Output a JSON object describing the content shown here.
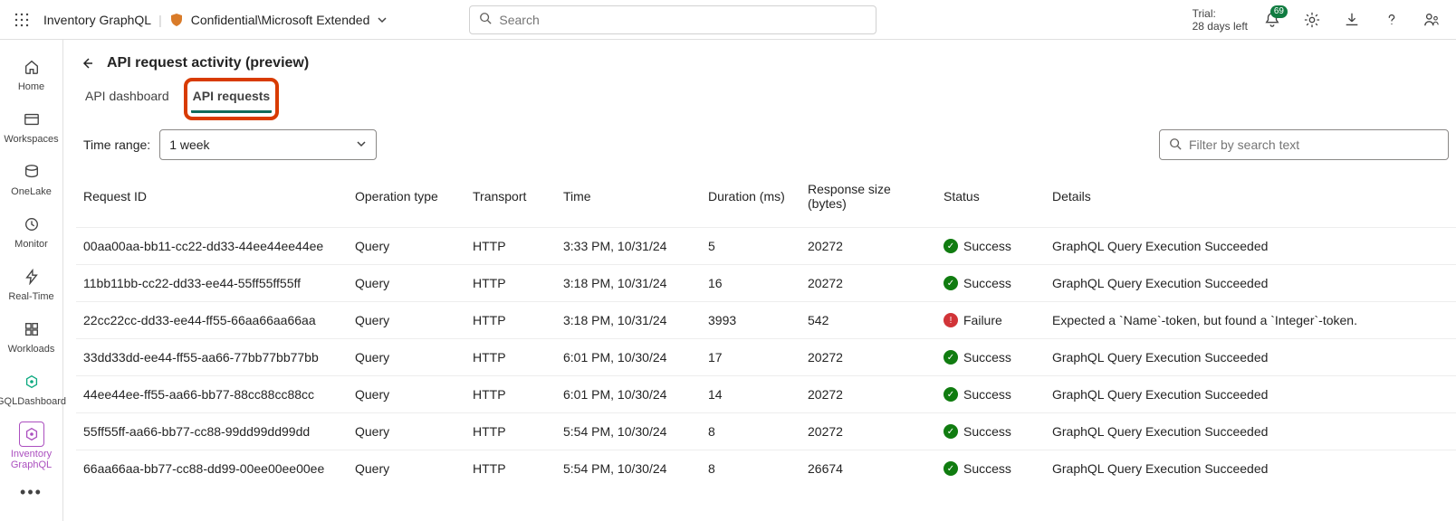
{
  "header": {
    "breadcrumb": {
      "item": "Inventory GraphQL",
      "sensitivity": "Confidential\\Microsoft Extended"
    },
    "search_placeholder": "Search",
    "trial_label": "Trial:",
    "trial_days": "28 days left",
    "notification_count": "69"
  },
  "rail": {
    "items": [
      {
        "label": "Home"
      },
      {
        "label": "Workspaces"
      },
      {
        "label": "OneLake"
      },
      {
        "label": "Monitor"
      },
      {
        "label": "Real-Time"
      },
      {
        "label": "Workloads"
      },
      {
        "label": "GQLDashboard"
      },
      {
        "label": "Inventory GraphQL"
      }
    ]
  },
  "page": {
    "title": "API request activity (preview)",
    "tabs": [
      {
        "label": "API dashboard"
      },
      {
        "label": "API requests"
      }
    ],
    "time_range_label": "Time range:",
    "time_range_value": "1 week",
    "filter_placeholder": "Filter by search text"
  },
  "columns": {
    "id": "Request ID",
    "op": "Operation type",
    "tr": "Transport",
    "time": "Time",
    "dur": "Duration (ms)",
    "size": "Response size (bytes)",
    "status": "Status",
    "details": "Details"
  },
  "rows": [
    {
      "id": "00aa00aa-bb11-cc22-dd33-44ee44ee44ee",
      "op": "Query",
      "tr": "HTTP",
      "time": "3:33 PM, 10/31/24",
      "dur": "5",
      "size": "20272",
      "status": "Success",
      "details": "GraphQL Query Execution Succeeded"
    },
    {
      "id": "11bb11bb-cc22-dd33-ee44-55ff55ff55ff",
      "op": "Query",
      "tr": "HTTP",
      "time": "3:18 PM, 10/31/24",
      "dur": "16",
      "size": "20272",
      "status": "Success",
      "details": "GraphQL Query Execution Succeeded"
    },
    {
      "id": "22cc22cc-dd33-ee44-ff55-66aa66aa66aa",
      "op": "Query",
      "tr": "HTTP",
      "time": "3:18 PM, 10/31/24",
      "dur": "3993",
      "size": "542",
      "status": "Failure",
      "details": "Expected a `Name`-token, but found a `Integer`-token."
    },
    {
      "id": "33dd33dd-ee44-ff55-aa66-77bb77bb77bb",
      "op": "Query",
      "tr": "HTTP",
      "time": "6:01 PM, 10/30/24",
      "dur": "17",
      "size": "20272",
      "status": "Success",
      "details": "GraphQL Query Execution Succeeded"
    },
    {
      "id": "44ee44ee-ff55-aa66-bb77-88cc88cc88cc",
      "op": "Query",
      "tr": "HTTP",
      "time": "6:01 PM, 10/30/24",
      "dur": "14",
      "size": "20272",
      "status": "Success",
      "details": "GraphQL Query Execution Succeeded"
    },
    {
      "id": "55ff55ff-aa66-bb77-cc88-99dd99dd99dd",
      "op": "Query",
      "tr": "HTTP",
      "time": "5:54 PM, 10/30/24",
      "dur": "8",
      "size": "20272",
      "status": "Success",
      "details": "GraphQL Query Execution Succeeded"
    },
    {
      "id": "66aa66aa-bb77-cc88-dd99-00ee00ee00ee",
      "op": "Query",
      "tr": "HTTP",
      "time": "5:54 PM, 10/30/24",
      "dur": "8",
      "size": "26674",
      "status": "Success",
      "details": "GraphQL Query Execution Succeeded"
    }
  ]
}
